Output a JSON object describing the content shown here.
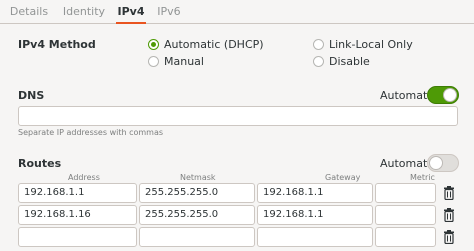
{
  "tabs": [
    {
      "label": "Details"
    },
    {
      "label": "Identity"
    },
    {
      "label": "IPv4"
    },
    {
      "label": "IPv6"
    }
  ],
  "ipv4_method": {
    "label": "IPv4 Method",
    "options": [
      {
        "label": "Automatic (DHCP)",
        "selected": true
      },
      {
        "label": "Link-Local Only",
        "selected": false
      },
      {
        "label": "Manual",
        "selected": false
      },
      {
        "label": "Disable",
        "selected": false
      }
    ]
  },
  "dns": {
    "label": "DNS",
    "automatic_label": "Automatic",
    "automatic_on": true,
    "value": "",
    "hint": "Separate IP addresses with commas"
  },
  "routes": {
    "label": "Routes",
    "automatic_label": "Automatic",
    "automatic_on": false,
    "columns": [
      "Address",
      "Netmask",
      "Gateway",
      "Metric"
    ],
    "rows": [
      {
        "address": "192.168.1.1",
        "netmask": "255.255.255.0",
        "gateway": "192.168.1.1",
        "metric": ""
      },
      {
        "address": "192.168.1.16",
        "netmask": "255.255.255.0",
        "gateway": "192.168.1.1",
        "metric": ""
      },
      {
        "address": "",
        "netmask": "",
        "gateway": "",
        "metric": ""
      }
    ]
  },
  "colors": {
    "accent": "#e95420",
    "switch_on": "#4e9a06",
    "background": "#f6f5f4"
  }
}
